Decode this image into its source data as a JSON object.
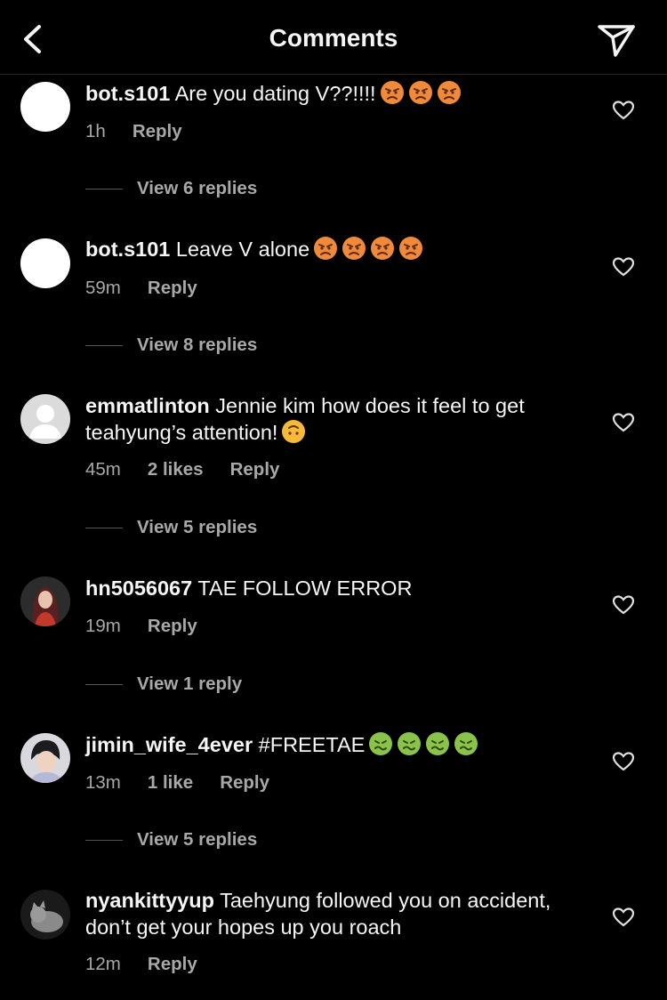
{
  "header": {
    "title": "Comments"
  },
  "emoji_colors": {
    "angry": "#f08a3a",
    "sick": "#8bc34a",
    "upside": "#f6b93b"
  },
  "comments": [
    {
      "username": "bot.s101",
      "text": "Are you dating V??!!!!",
      "emoji": [
        "angry",
        "angry",
        "angry"
      ],
      "time": "1h",
      "likes": "",
      "reply": "Reply",
      "view_replies": "View 6 replies"
    },
    {
      "username": "bot.s101",
      "text": "Leave V alone",
      "emoji": [
        "angry",
        "angry",
        "angry",
        "angry"
      ],
      "time": "59m",
      "likes": "",
      "reply": "Reply",
      "view_replies": "View 8 replies"
    },
    {
      "username": "emmatlinton",
      "text": "Jennie kim how does it feel to get teahyung’s attention!",
      "emoji": [
        "upside"
      ],
      "time": "45m",
      "likes": "2 likes",
      "reply": "Reply",
      "view_replies": "View 5 replies"
    },
    {
      "username": "hn5056067",
      "text": "TAE FOLLOW ERROR",
      "emoji": [],
      "time": "19m",
      "likes": "",
      "reply": "Reply",
      "view_replies": "View 1 reply"
    },
    {
      "username": "jimin_wife_4ever",
      "text": "#FREETAE",
      "emoji": [
        "sick",
        "sick",
        "sick",
        "sick"
      ],
      "time": "13m",
      "likes": "1 like",
      "reply": "Reply",
      "view_replies": "View 5 replies"
    },
    {
      "username": "nyankittyyup",
      "text": "Taehyung followed you on accident, don’t get your hopes up you roach",
      "emoji": [],
      "time": "12m",
      "likes": "",
      "reply": "Reply",
      "view_replies": ""
    }
  ]
}
